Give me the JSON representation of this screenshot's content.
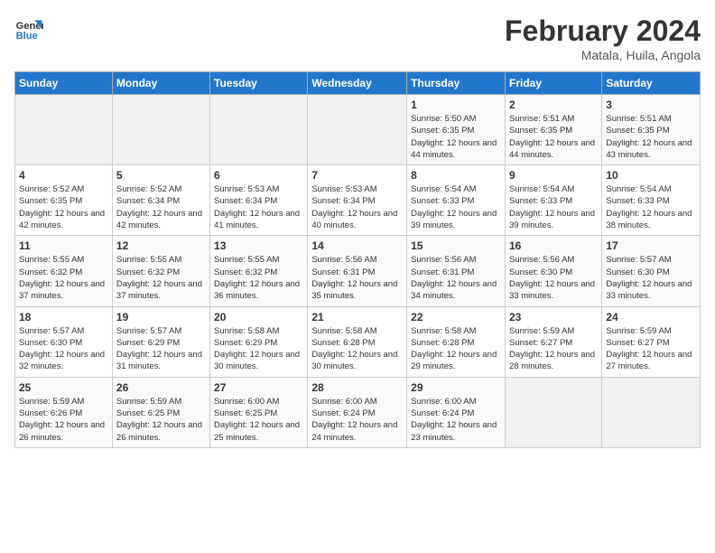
{
  "logo": {
    "line1": "General",
    "line2": "Blue"
  },
  "title": "February 2024",
  "subtitle": "Matala, Huila, Angola",
  "days_header": [
    "Sunday",
    "Monday",
    "Tuesday",
    "Wednesday",
    "Thursday",
    "Friday",
    "Saturday"
  ],
  "weeks": [
    [
      {
        "num": "",
        "sunrise": "",
        "sunset": "",
        "daylight": ""
      },
      {
        "num": "",
        "sunrise": "",
        "sunset": "",
        "daylight": ""
      },
      {
        "num": "",
        "sunrise": "",
        "sunset": "",
        "daylight": ""
      },
      {
        "num": "",
        "sunrise": "",
        "sunset": "",
        "daylight": ""
      },
      {
        "num": "1",
        "sunrise": "Sunrise: 5:50 AM",
        "sunset": "Sunset: 6:35 PM",
        "daylight": "Daylight: 12 hours and 44 minutes."
      },
      {
        "num": "2",
        "sunrise": "Sunrise: 5:51 AM",
        "sunset": "Sunset: 6:35 PM",
        "daylight": "Daylight: 12 hours and 44 minutes."
      },
      {
        "num": "3",
        "sunrise": "Sunrise: 5:51 AM",
        "sunset": "Sunset: 6:35 PM",
        "daylight": "Daylight: 12 hours and 43 minutes."
      }
    ],
    [
      {
        "num": "4",
        "sunrise": "Sunrise: 5:52 AM",
        "sunset": "Sunset: 6:35 PM",
        "daylight": "Daylight: 12 hours and 42 minutes."
      },
      {
        "num": "5",
        "sunrise": "Sunrise: 5:52 AM",
        "sunset": "Sunset: 6:34 PM",
        "daylight": "Daylight: 12 hours and 42 minutes."
      },
      {
        "num": "6",
        "sunrise": "Sunrise: 5:53 AM",
        "sunset": "Sunset: 6:34 PM",
        "daylight": "Daylight: 12 hours and 41 minutes."
      },
      {
        "num": "7",
        "sunrise": "Sunrise: 5:53 AM",
        "sunset": "Sunset: 6:34 PM",
        "daylight": "Daylight: 12 hours and 40 minutes."
      },
      {
        "num": "8",
        "sunrise": "Sunrise: 5:54 AM",
        "sunset": "Sunset: 6:33 PM",
        "daylight": "Daylight: 12 hours and 39 minutes."
      },
      {
        "num": "9",
        "sunrise": "Sunrise: 5:54 AM",
        "sunset": "Sunset: 6:33 PM",
        "daylight": "Daylight: 12 hours and 39 minutes."
      },
      {
        "num": "10",
        "sunrise": "Sunrise: 5:54 AM",
        "sunset": "Sunset: 6:33 PM",
        "daylight": "Daylight: 12 hours and 38 minutes."
      }
    ],
    [
      {
        "num": "11",
        "sunrise": "Sunrise: 5:55 AM",
        "sunset": "Sunset: 6:32 PM",
        "daylight": "Daylight: 12 hours and 37 minutes."
      },
      {
        "num": "12",
        "sunrise": "Sunrise: 5:55 AM",
        "sunset": "Sunset: 6:32 PM",
        "daylight": "Daylight: 12 hours and 37 minutes."
      },
      {
        "num": "13",
        "sunrise": "Sunrise: 5:55 AM",
        "sunset": "Sunset: 6:32 PM",
        "daylight": "Daylight: 12 hours and 36 minutes."
      },
      {
        "num": "14",
        "sunrise": "Sunrise: 5:56 AM",
        "sunset": "Sunset: 6:31 PM",
        "daylight": "Daylight: 12 hours and 35 minutes."
      },
      {
        "num": "15",
        "sunrise": "Sunrise: 5:56 AM",
        "sunset": "Sunset: 6:31 PM",
        "daylight": "Daylight: 12 hours and 34 minutes."
      },
      {
        "num": "16",
        "sunrise": "Sunrise: 5:56 AM",
        "sunset": "Sunset: 6:30 PM",
        "daylight": "Daylight: 12 hours and 33 minutes."
      },
      {
        "num": "17",
        "sunrise": "Sunrise: 5:57 AM",
        "sunset": "Sunset: 6:30 PM",
        "daylight": "Daylight: 12 hours and 33 minutes."
      }
    ],
    [
      {
        "num": "18",
        "sunrise": "Sunrise: 5:57 AM",
        "sunset": "Sunset: 6:30 PM",
        "daylight": "Daylight: 12 hours and 32 minutes."
      },
      {
        "num": "19",
        "sunrise": "Sunrise: 5:57 AM",
        "sunset": "Sunset: 6:29 PM",
        "daylight": "Daylight: 12 hours and 31 minutes."
      },
      {
        "num": "20",
        "sunrise": "Sunrise: 5:58 AM",
        "sunset": "Sunset: 6:29 PM",
        "daylight": "Daylight: 12 hours and 30 minutes."
      },
      {
        "num": "21",
        "sunrise": "Sunrise: 5:58 AM",
        "sunset": "Sunset: 6:28 PM",
        "daylight": "Daylight: 12 hours and 30 minutes."
      },
      {
        "num": "22",
        "sunrise": "Sunrise: 5:58 AM",
        "sunset": "Sunset: 6:28 PM",
        "daylight": "Daylight: 12 hours and 29 minutes."
      },
      {
        "num": "23",
        "sunrise": "Sunrise: 5:59 AM",
        "sunset": "Sunset: 6:27 PM",
        "daylight": "Daylight: 12 hours and 28 minutes."
      },
      {
        "num": "24",
        "sunrise": "Sunrise: 5:59 AM",
        "sunset": "Sunset: 6:27 PM",
        "daylight": "Daylight: 12 hours and 27 minutes."
      }
    ],
    [
      {
        "num": "25",
        "sunrise": "Sunrise: 5:59 AM",
        "sunset": "Sunset: 6:26 PM",
        "daylight": "Daylight: 12 hours and 26 minutes."
      },
      {
        "num": "26",
        "sunrise": "Sunrise: 5:59 AM",
        "sunset": "Sunset: 6:25 PM",
        "daylight": "Daylight: 12 hours and 26 minutes."
      },
      {
        "num": "27",
        "sunrise": "Sunrise: 6:00 AM",
        "sunset": "Sunset: 6:25 PM",
        "daylight": "Daylight: 12 hours and 25 minutes."
      },
      {
        "num": "28",
        "sunrise": "Sunrise: 6:00 AM",
        "sunset": "Sunset: 6:24 PM",
        "daylight": "Daylight: 12 hours and 24 minutes."
      },
      {
        "num": "29",
        "sunrise": "Sunrise: 6:00 AM",
        "sunset": "Sunset: 6:24 PM",
        "daylight": "Daylight: 12 hours and 23 minutes."
      },
      {
        "num": "",
        "sunrise": "",
        "sunset": "",
        "daylight": ""
      },
      {
        "num": "",
        "sunrise": "",
        "sunset": "",
        "daylight": ""
      }
    ]
  ]
}
